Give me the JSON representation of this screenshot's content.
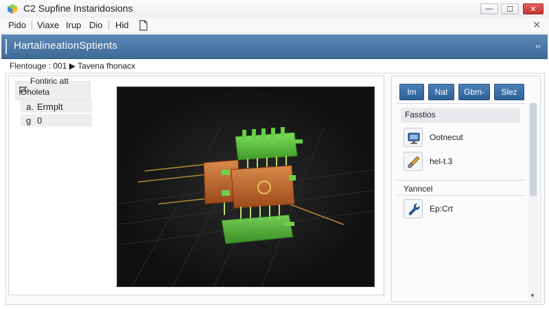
{
  "window": {
    "title": "C2 Supfine Instaridosions",
    "icon": "app-cube-icon",
    "controls": {
      "minimize": "—",
      "maximize": "☐",
      "close": "✕"
    }
  },
  "menubar": {
    "items": [
      "Pido",
      "Viaxe",
      "Irup",
      "Dio",
      "Hid"
    ],
    "extra_icon": "document-icon",
    "close_icon": "✕"
  },
  "panel": {
    "title": "HartalineationSptients",
    "collapse_glyph": "›‹"
  },
  "breadcrumb": "Flentouge : 001 ▶ Tavena fhonacx",
  "properties": {
    "header_line1": "Fontiric att",
    "header_line2": "Oholeta",
    "rows": [
      {
        "key": "a.",
        "value": "Ermplt"
      },
      {
        "key": "g",
        "value": "0"
      }
    ]
  },
  "toolbar": {
    "buttons": [
      "Im",
      "Nat",
      "Gbm-",
      "Slez"
    ]
  },
  "sections": [
    {
      "title": "Fasstios",
      "items": [
        {
          "icon": "monitor-icon",
          "label": "Ootnecut"
        },
        {
          "icon": "brush-icon",
          "label": "hel-t.3"
        }
      ]
    },
    {
      "title": "Yanncel",
      "items": [
        {
          "icon": "wrench-icon",
          "label": "Ep:Crt"
        }
      ]
    }
  ],
  "colors": {
    "header_blue": "#4a77a8",
    "button_blue": "#3a6ea6",
    "viewport_bg": "#121212",
    "component_orange": "#c8692d",
    "component_green": "#5fbf3c"
  }
}
